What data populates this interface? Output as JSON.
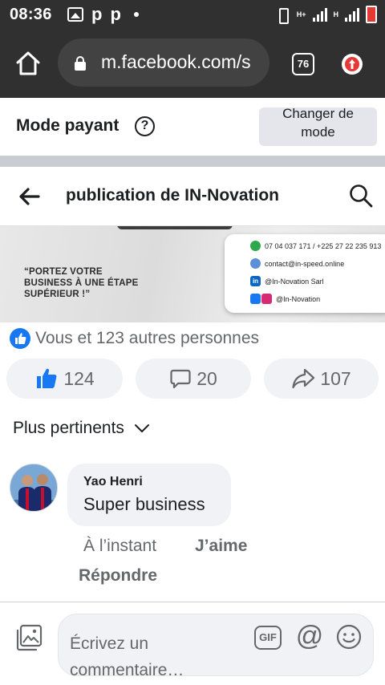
{
  "status_bar": {
    "time": "08:36",
    "left_icons": [
      "image-icon",
      "p-app-icon",
      "p-app-icon",
      "dot-icon"
    ],
    "p_glyph": "p",
    "right_icons": [
      "vibrate-icon",
      "signal-icon",
      "signal-icon",
      "battery-icon"
    ],
    "network_labels": [
      "H+",
      "H"
    ],
    "battery_color": "#e53935"
  },
  "browser": {
    "url": "m.facebook.com/s",
    "tab_count": "76",
    "icons": [
      "home-icon",
      "lock-icon",
      "upgrade-icon"
    ]
  },
  "mode_banner": {
    "title": "Mode payant",
    "help_glyph": "?",
    "button_line1": "Changer de",
    "button_line2": "mode"
  },
  "header": {
    "title": "publication de IN-Novation"
  },
  "post_image": {
    "slogan_line1": "“PORTEZ VOTRE",
    "slogan_line2": "BUSINESS À UNE ÉTAPE",
    "slogan_line3": "SUPÉRIEUR !”",
    "phone": "07 04 037 171 / +225 27 22 235 913",
    "email": "contact@in-speed.online",
    "linkedin": "@In-Novation Sarl",
    "social": "@In-Novation",
    "linkedin_glyph": "in"
  },
  "reactions": {
    "summary": "Vous et 123 autres personnes",
    "like_count": "124",
    "comment_count": "20",
    "share_count": "107"
  },
  "comments": {
    "sort_label": "Plus pertinents",
    "items": [
      {
        "author": "Yao Henri",
        "text": "Super business",
        "time": "À l’instant",
        "like_label": "J’aime",
        "reply_label": "Répondre"
      }
    ]
  },
  "composer": {
    "placeholder_line1": "Écrivez un",
    "placeholder_line2": "commentaire…",
    "gif_label": "GIF",
    "at_label": "@"
  },
  "colors": {
    "facebook_blue": "#1877f2",
    "status_bar": "#303030",
    "secondary_text": "#65676b",
    "bubble_bg": "#f0f2f5"
  }
}
